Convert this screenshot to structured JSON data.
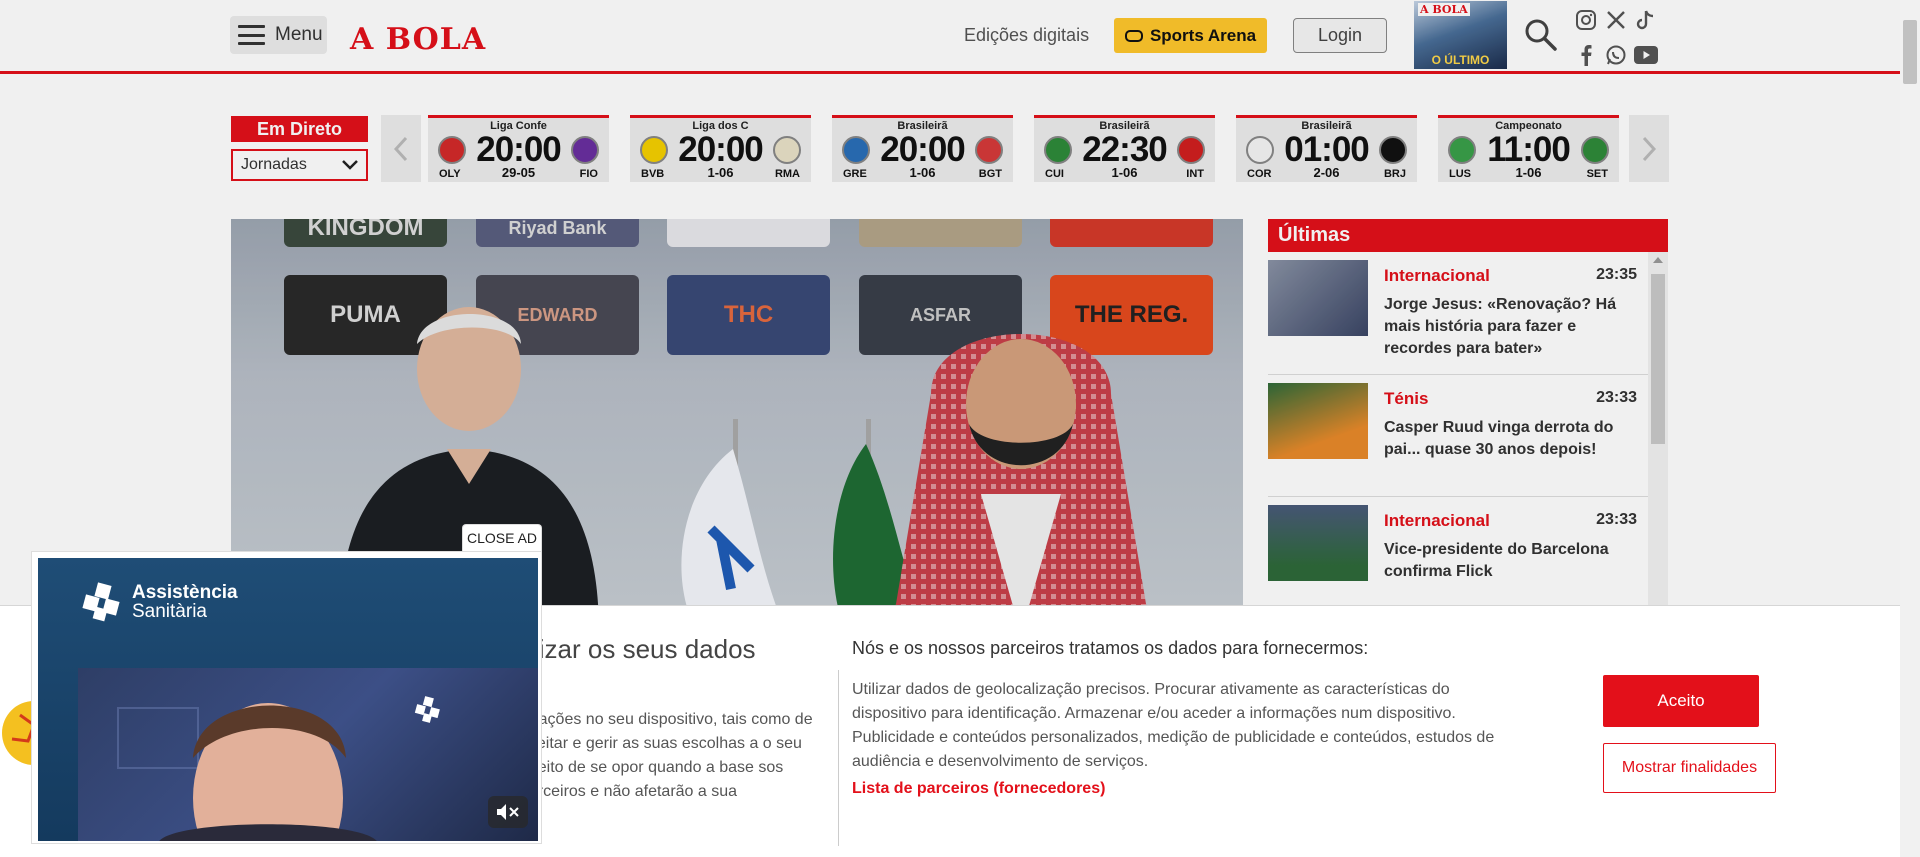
{
  "header": {
    "menu_label": "Menu",
    "logo": "A BOLA",
    "edicoes_label": "Edições digitais",
    "sports_arena_label": "Sports Arena",
    "login_label": "Login",
    "cover_top": "A BOLA",
    "cover_bottom": "O ÚLTIMO",
    "social_icons": [
      "instagram-icon",
      "x-icon",
      "tiktok-icon",
      "facebook-icon",
      "whatsapp-icon",
      "youtube-icon"
    ]
  },
  "scores": {
    "em_direto_label": "Em Direto",
    "jornadas_value": "Jornadas",
    "games": [
      {
        "league": "Liga Confe",
        "time": "20:00",
        "date": "29-05",
        "home": "OLY",
        "away": "FIO",
        "home_color": "#d32a2a",
        "away_color": "#6a2fa0"
      },
      {
        "league": "Liga dos C",
        "time": "20:00",
        "date": "1-06",
        "home": "BVB",
        "away": "RMA",
        "home_color": "#f5d000",
        "away_color": "#e9e2c8"
      },
      {
        "league": "Brasileirã",
        "time": "20:00",
        "date": "1-06",
        "home": "GRE",
        "away": "BGT",
        "home_color": "#2a6fb8",
        "away_color": "#d63a3a"
      },
      {
        "league": "Brasileirã",
        "time": "22:30",
        "date": "1-06",
        "home": "CUI",
        "away": "INT",
        "home_color": "#2e8b3a",
        "away_color": "#d11f1f"
      },
      {
        "league": "Brasileirã",
        "time": "01:00",
        "date": "2-06",
        "home": "COR",
        "away": "BRJ",
        "home_color": "#f5f5f5",
        "away_color": "#111111"
      },
      {
        "league": "Campeonato",
        "time": "11:00",
        "date": "1-06",
        "home": "LUS",
        "away": "SET",
        "home_color": "#3aa04a",
        "away_color": "#2f8b3a"
      }
    ]
  },
  "hero": {
    "sponsors_row1": [
      "KINGDOM",
      "Riyad Bank",
      "",
      "",
      ""
    ],
    "sponsors_row2": [
      "PUMA",
      "EDWARD",
      "THC",
      "ASFAR",
      "THE REG."
    ]
  },
  "ultimas": {
    "title": "Últimas",
    "items": [
      {
        "category": "Internacional",
        "time": "23:35",
        "title": "Jorge Jesus: «Renovação? Há mais história para fazer e recordes para bater»"
      },
      {
        "category": "Ténis",
        "time": "23:33",
        "title": "Casper Ruud vinga derrota do pai... quase 30 anos depois!"
      },
      {
        "category": "Internacional",
        "time": "23:33",
        "title": "Vice-presidente do Barcelona confirma Flick"
      }
    ]
  },
  "consent": {
    "left_title": "tilizar os seus dados",
    "left_text": "rmações no seu dispositivo, tais como de aceitar e gerir as suas escolhas a o seu direito de se opor quando a base sos parceiros e não afetarão a sua",
    "right_title": "Nós e os nossos parceiros tratamos os dados para fornecermos:",
    "right_text": "Utilizar dados de geolocalização precisos. Procurar ativamente as características do dispositivo para identificação. Armazenar e/ou aceder a informações num dispositivo. Publicidade e conteúdos personalizados, medição de publicidade e conteúdos, estudos de audiência e desenvolvimento de serviços.",
    "partners_link": "Lista de parceiros (fornecedores)",
    "accept_label": "Aceito",
    "show_purposes_label": "Mostrar finalidades"
  },
  "ad": {
    "close_label": "CLOSE AD",
    "brand_line1": "Assistència",
    "brand_line2": "Sanitària"
  },
  "colors": {
    "accent": "#e3101a",
    "arena": "#ffc72c",
    "ad_bg": "#1f4d76"
  }
}
